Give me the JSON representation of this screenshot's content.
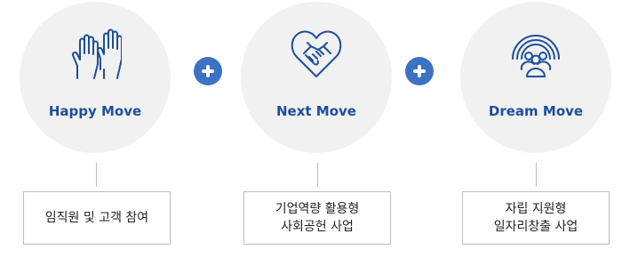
{
  "items": [
    {
      "title": "Happy Move",
      "icon": "raised-hands-icon",
      "lines": [
        "임직원 및 고객 참여"
      ]
    },
    {
      "title": "Next Move",
      "icon": "handshake-heart-icon",
      "lines": [
        "기업역량 활용형",
        "사회공헌 사업"
      ]
    },
    {
      "title": "Dream Move",
      "icon": "rainbow-people-icon",
      "lines": [
        "자립 지원형",
        "일자리창출 사업"
      ]
    }
  ],
  "colors": {
    "accent": "#1d4f9a",
    "plus": "#3b72c4",
    "circle": "#f1f1f1",
    "line": "#bdbdbd"
  }
}
